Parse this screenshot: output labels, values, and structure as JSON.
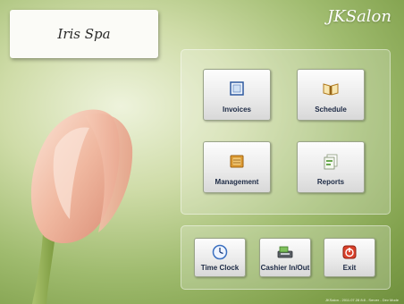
{
  "brand": {
    "salon_name": "Iris Spa",
    "app_title": "JKSalon"
  },
  "main_buttons": [
    {
      "label": "Invoices",
      "icon": "invoice-icon"
    },
    {
      "label": "Schedule",
      "icon": "book-icon"
    },
    {
      "label": "Management",
      "icon": "folder-icon"
    },
    {
      "label": "Reports",
      "icon": "reports-icon"
    }
  ],
  "bottom_buttons": [
    {
      "label": "Time Clock",
      "icon": "clock-icon"
    },
    {
      "label": "Cashier In/Out",
      "icon": "cashier-icon"
    },
    {
      "label": "Exit",
      "icon": "exit-icon"
    }
  ],
  "footer": {
    "text": "JKSalon - 2011.07.28 8:8 - Server - Dev Mode"
  },
  "colors": {
    "accent_green": "#8fae5a",
    "exit_red": "#d9412b",
    "label_navy": "#1d2a45"
  }
}
